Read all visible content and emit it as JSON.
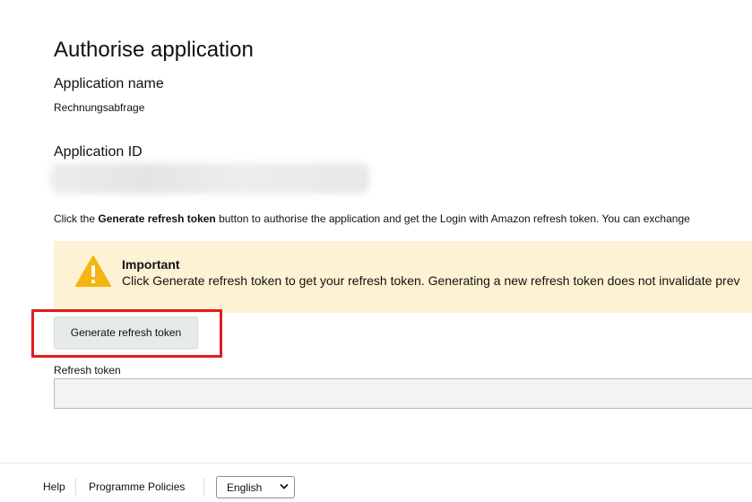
{
  "page": {
    "title": "Authorise application"
  },
  "application": {
    "name_label": "Application name",
    "name_value": "Rechnungsabfrage",
    "id_label": "Application ID"
  },
  "instruction": {
    "prefix": "Click the ",
    "bold": "Generate refresh token",
    "suffix": " button to authorise the application and get the Login with Amazon refresh token. You can exchange"
  },
  "alert": {
    "title": "Important",
    "text": "Click Generate refresh token to get your refresh token. Generating a new refresh token does not invalidate prev",
    "icon": "warning-icon",
    "color": "#f5b50e"
  },
  "actions": {
    "generate_label": "Generate refresh token"
  },
  "refresh_token": {
    "label": "Refresh token",
    "value": ""
  },
  "footer": {
    "help": "Help",
    "policies": "Programme Policies",
    "language": "English"
  },
  "colors": {
    "highlight": "#e21d1d",
    "alert_background": "#fdf3d4"
  }
}
